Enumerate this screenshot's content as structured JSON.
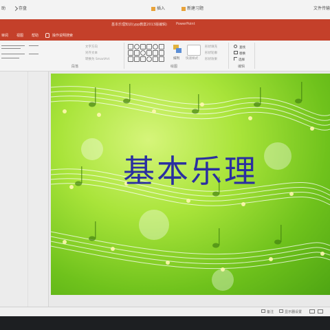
{
  "topbar": {
    "left_item": "助",
    "save_item": "存盘",
    "insert_item": "插入",
    "newdoc_item": "新建习题",
    "right_item": "文件传输"
  },
  "titlebar": {
    "doc_title": "基本乐理知识(ypp教案2013版编辑)",
    "app_name": "PowerPoint"
  },
  "tabs": [
    "审阅",
    "视图",
    "帮助",
    "操作说明搜索"
  ],
  "ribbon": {
    "groups": {
      "paragraph": "段落",
      "drawing": "绘图",
      "editing": "编辑"
    },
    "arrange_label": "排列",
    "quick_styles_label": "快速样式",
    "find_label": "查找",
    "replace_label": "替换",
    "select_label": "选择",
    "text_direction": "文字方向",
    "align_text": "对齐文本",
    "smartart": "转换为 SmartArt",
    "shape_fill": "形状填充",
    "shape_outline": "形状轮廓",
    "shape_effects": "形状效果"
  },
  "slide": {
    "title": "基本乐理",
    "colors": {
      "bg_light": "#d6f57a",
      "bg_dark": "#4ea513",
      "title_color": "#2a2fa0"
    }
  },
  "statusbar": {
    "notes": "备注",
    "display_settings": "显示器设置"
  }
}
